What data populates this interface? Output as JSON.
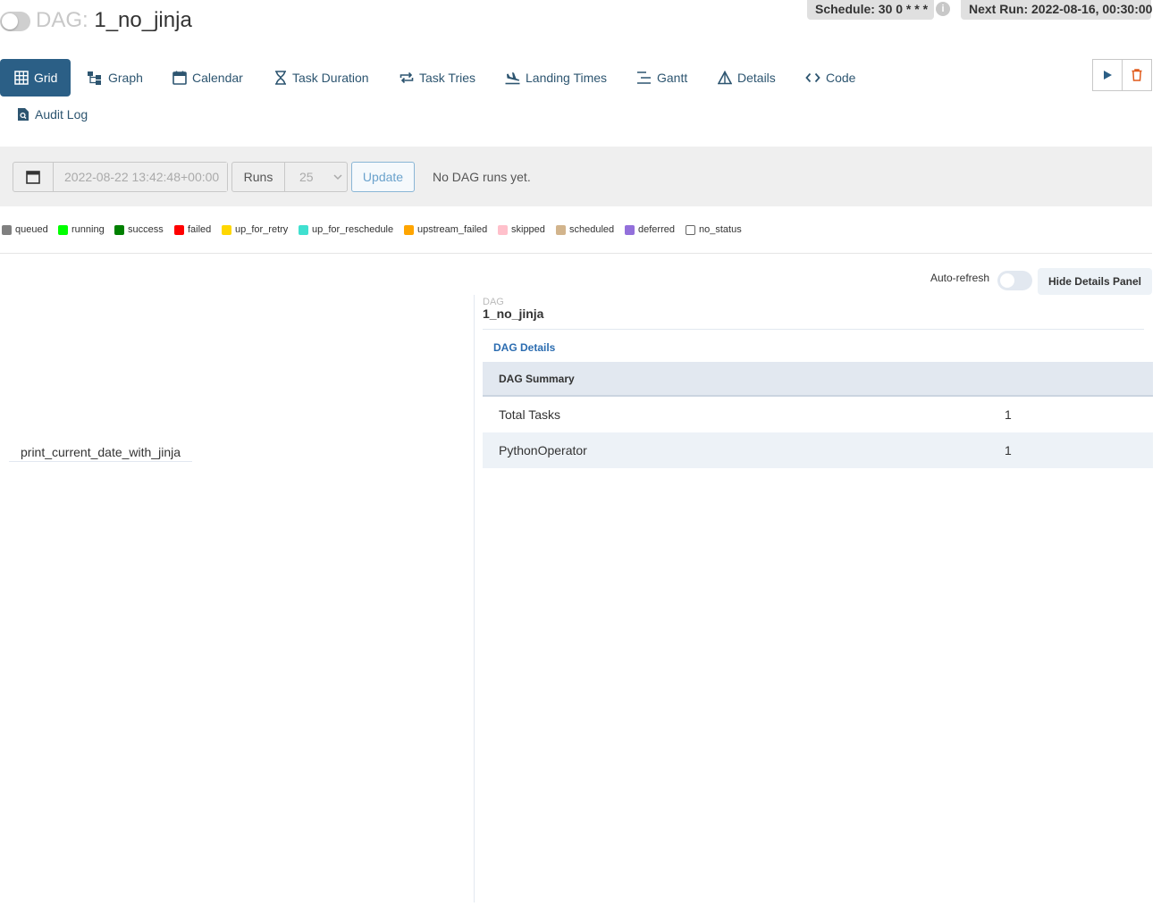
{
  "header": {
    "dag_prefix": "DAG:",
    "dag_name": "1_no_jinja",
    "schedule": "Schedule: 30 0 * * *",
    "next_run": "Next Run: 2022-08-16, 00:30:00",
    "info_glyph": "i"
  },
  "tabs": [
    {
      "label": "Grid",
      "icon": "grid-icon"
    },
    {
      "label": "Graph",
      "icon": "graph-icon"
    },
    {
      "label": "Calendar",
      "icon": "calendar-icon"
    },
    {
      "label": "Task Duration",
      "icon": "hourglass-icon"
    },
    {
      "label": "Task Tries",
      "icon": "repeat-icon"
    },
    {
      "label": "Landing Times",
      "icon": "plane-landing-icon"
    },
    {
      "label": "Gantt",
      "icon": "gantt-icon"
    },
    {
      "label": "Details",
      "icon": "triangle-icon"
    },
    {
      "label": "Code",
      "icon": "code-icon"
    },
    {
      "label": "Audit Log",
      "icon": "document-search-icon"
    }
  ],
  "controls": {
    "date_value": "2022-08-22 13:42:48+00:00",
    "runs_label": "Runs",
    "runs_value": "25",
    "update_label": "Update",
    "no_runs_text": "No DAG runs yet."
  },
  "legend": [
    {
      "label": "queued",
      "color": "#808080"
    },
    {
      "label": "running",
      "color": "#00ff00"
    },
    {
      "label": "success",
      "color": "#008000"
    },
    {
      "label": "failed",
      "color": "#ff0000"
    },
    {
      "label": "up_for_retry",
      "color": "#ffd700"
    },
    {
      "label": "up_for_reschedule",
      "color": "#40e0d0"
    },
    {
      "label": "upstream_failed",
      "color": "#ffa500"
    },
    {
      "label": "skipped",
      "color": "#ffc0cb"
    },
    {
      "label": "scheduled",
      "color": "#d2b48c"
    },
    {
      "label": "deferred",
      "color": "#9370db"
    },
    {
      "label": "no_status",
      "color": "#ffffff"
    }
  ],
  "grid": {
    "auto_refresh_label": "Auto-refresh",
    "hide_details_label": "Hide Details Panel",
    "tasks": [
      "print_current_date_with_jinja"
    ]
  },
  "details": {
    "crumb_label": "DAG",
    "crumb_value": "1_no_jinja",
    "tab_label": "DAG Details",
    "summary_title": "DAG Summary",
    "rows": [
      {
        "key": "Total Tasks",
        "value": "1"
      },
      {
        "key": "PythonOperator",
        "value": "1"
      }
    ]
  }
}
